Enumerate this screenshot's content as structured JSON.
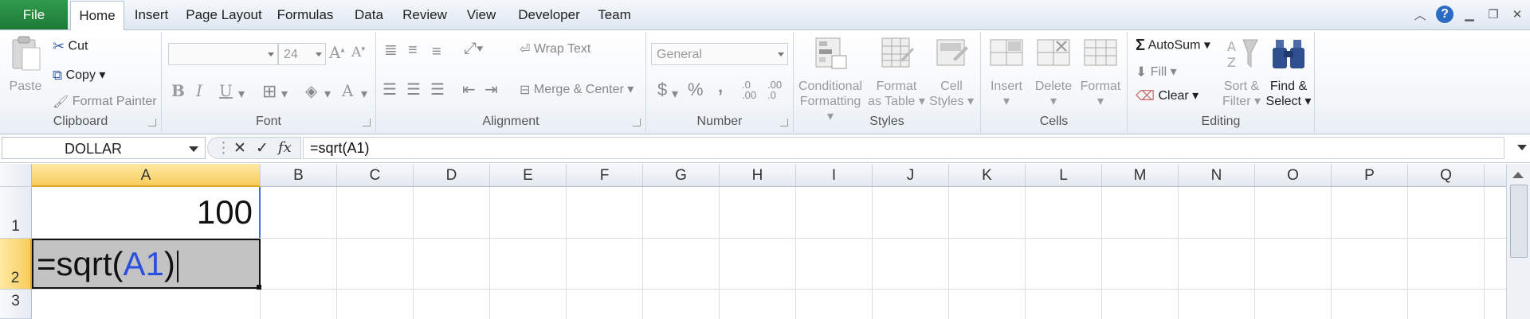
{
  "tabs": [
    "File",
    "Home",
    "Insert",
    "Page Layout",
    "Formulas",
    "Data",
    "Review",
    "View",
    "Developer",
    "Team"
  ],
  "ribbon": {
    "clipboard": {
      "label": "Clipboard",
      "paste": "Paste",
      "cut": "Cut",
      "copy": "Copy",
      "format_painter": "Format Painter"
    },
    "font": {
      "label": "Font",
      "font_name": "",
      "font_size": "24",
      "bold": "B",
      "italic": "I",
      "underline": "U"
    },
    "alignment": {
      "label": "Alignment",
      "wrap_text": "Wrap Text",
      "merge_center": "Merge & Center"
    },
    "number": {
      "label": "Number",
      "format": "General",
      "currency": "$",
      "percent": "%",
      "comma": ",",
      "inc_decimal": ".0\n.00",
      "dec_decimal": ".00\n.0"
    },
    "styles": {
      "label": "Styles",
      "conditional": "Conditional",
      "conditional2": "Formatting",
      "format_table": "Format",
      "format_table2": "as Table",
      "cell_styles": "Cell",
      "cell_styles2": "Styles"
    },
    "cells": {
      "label": "Cells",
      "insert": "Insert",
      "delete": "Delete",
      "format": "Format"
    },
    "editing": {
      "label": "Editing",
      "autosum": "AutoSum",
      "fill": "Fill",
      "clear": "Clear",
      "sort": "Sort &",
      "sort2": "Filter",
      "find": "Find &",
      "find2": "Select"
    }
  },
  "formula_bar": {
    "name_box": "DOLLAR",
    "formula": "=sqrt(A1)",
    "cancel": "✕",
    "enter": "✓",
    "fx": "fx"
  },
  "grid": {
    "columns": [
      "A",
      "B",
      "C",
      "D",
      "E",
      "F",
      "G",
      "H",
      "I",
      "J",
      "K",
      "L",
      "M",
      "N",
      "O",
      "P",
      "Q"
    ],
    "rows": [
      "1",
      "2",
      "3"
    ],
    "A1": "100",
    "A2_prefix": "=sqrt(",
    "A2_ref": "A1",
    "A2_suffix": ")"
  },
  "colors": {
    "file_tab": "#1e7a37",
    "selected_header": "#f8cc5c",
    "reference": "#2c4fe0",
    "edit_cell": "#c3c3c3"
  }
}
